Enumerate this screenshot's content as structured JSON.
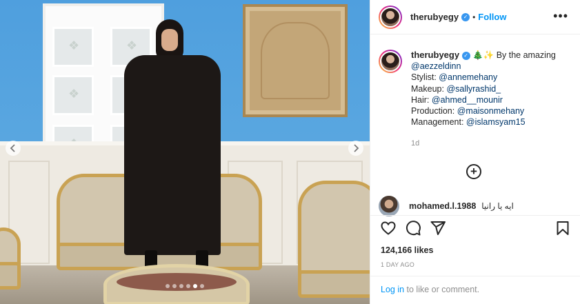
{
  "post": {
    "username": "therubyegy",
    "follow_label": "Follow",
    "separator": "•",
    "more_label": "•••",
    "carousel_total": 6,
    "carousel_active": 5
  },
  "caption": {
    "username": "therubyegy",
    "emoji_1": "🎄",
    "emoji_2": "✨",
    "intro": "By the amazing",
    "line1_mention": "@aezzeldinn",
    "line2_label": "Stylist:",
    "line2_mention": "@annemehany",
    "line3_label": "Makeup:",
    "line3_mention": "@sallyrashid_",
    "line4_label": "Hair:",
    "line4_mention": "@ahmed__mounir",
    "line5_label": "Production:",
    "line5_mention": "@maisonmehany",
    "line6_label": "Management:",
    "line6_mention": "@islamsyam15",
    "time_ago": "1d"
  },
  "comment": {
    "username": "mohamed.l.1988",
    "text": "ايه يا رانيا"
  },
  "stats": {
    "likes": "124,166 likes",
    "date": "1 DAY AGO"
  },
  "footer": {
    "login_link": "Log in",
    "login_rest": " to like or comment."
  },
  "icons": {
    "verified": "verified-badge-icon",
    "add": "plus-circle-icon",
    "like": "heart-icon",
    "comment": "comment-bubble-icon",
    "share": "paper-plane-icon",
    "save": "bookmark-icon",
    "prev": "chevron-left-icon",
    "next": "chevron-right-icon"
  },
  "colors": {
    "link_blue": "#0095f6",
    "mention_blue": "#00376b",
    "verified_blue": "#3897f0",
    "muted_text": "#8e8e8e"
  }
}
